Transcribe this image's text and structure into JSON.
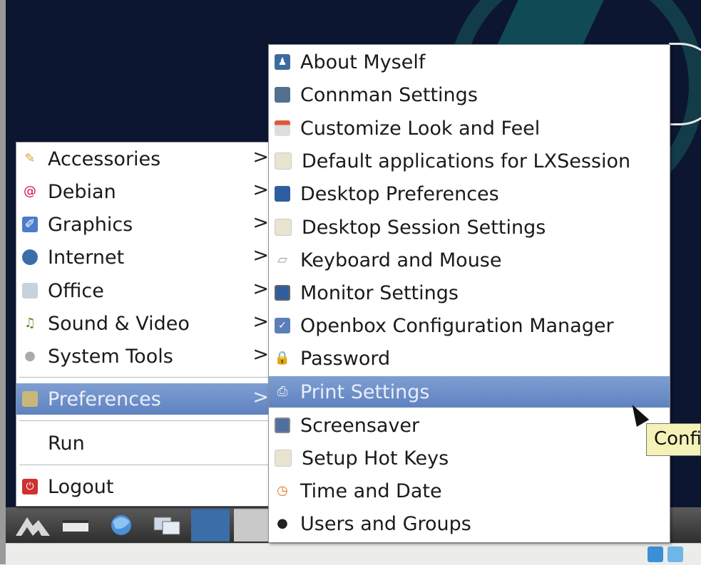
{
  "main_menu": {
    "items": [
      {
        "label": "Accessories",
        "icon": "accessories-icon",
        "color": "#d8a23a",
        "submenu": true
      },
      {
        "label": "Debian",
        "icon": "debian-swirl-icon",
        "color": "#d70a53",
        "submenu": true
      },
      {
        "label": "Graphics",
        "icon": "graphics-icon",
        "color": "#4a7cc9",
        "submenu": true
      },
      {
        "label": "Internet",
        "icon": "globe-icon",
        "color": "#3a6ea8",
        "submenu": true
      },
      {
        "label": "Office",
        "icon": "office-icon",
        "color": "#9ab",
        "submenu": true
      },
      {
        "label": "Sound & Video",
        "icon": "sound-video-icon",
        "color": "#5a8a2a",
        "submenu": true
      },
      {
        "label": "System Tools",
        "icon": "system-tools-icon",
        "color": "#aaa",
        "submenu": true
      },
      {
        "label": "Preferences",
        "icon": "preferences-icon",
        "color": "#c9b77a",
        "submenu": true,
        "highlighted": true
      },
      {
        "label": "Run",
        "submenu": false
      },
      {
        "label": "Logout",
        "icon": "logout-icon",
        "color": "#d03030",
        "submenu": false
      }
    ],
    "chevron": ">"
  },
  "preferences_menu": {
    "items": [
      {
        "label": "About Myself",
        "icon": "user-card-icon"
      },
      {
        "label": "Connman Settings",
        "icon": "network-icon"
      },
      {
        "label": "Customize Look and Feel",
        "icon": "appearance-icon"
      },
      {
        "label": "Default applications for LXSession",
        "icon": "lxsession-icon"
      },
      {
        "label": "Desktop Preferences",
        "icon": "desktop-icon"
      },
      {
        "label": "Desktop Session Settings",
        "icon": "session-icon"
      },
      {
        "label": "Keyboard and Mouse",
        "icon": "keyboard-icon"
      },
      {
        "label": "Monitor Settings",
        "icon": "monitor-icon"
      },
      {
        "label": "Openbox Configuration Manager",
        "icon": "openbox-icon"
      },
      {
        "label": "Password",
        "icon": "lock-icon"
      },
      {
        "label": "Print Settings",
        "icon": "printer-icon",
        "highlighted": true
      },
      {
        "label": "Screensaver",
        "icon": "screensaver-icon"
      },
      {
        "label": "Setup Hot Keys",
        "icon": "hotkeys-icon"
      },
      {
        "label": "Time and Date",
        "icon": "clock-icon"
      },
      {
        "label": "Users and Groups",
        "icon": "users-icon"
      }
    ]
  },
  "tooltip": {
    "text": "Confi"
  },
  "colors": {
    "highlight": "#6f90c9",
    "menu_bg": "#ffffff",
    "desktop_bg": "#0c1630"
  }
}
